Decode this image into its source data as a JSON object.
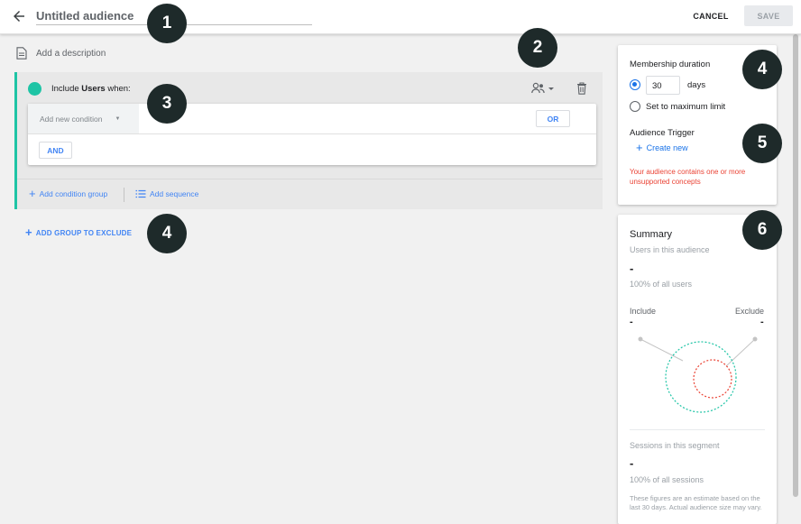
{
  "header": {
    "title": "Untitled audience",
    "cancel_label": "CANCEL",
    "save_label": "SAVE"
  },
  "main": {
    "description_placeholder": "Add a description",
    "include_prefix": "Include",
    "include_scope": "Users",
    "include_suffix": "when:",
    "condition_placeholder": "Add new condition",
    "or_label": "OR",
    "and_label": "AND",
    "add_condition_group": "Add condition group",
    "add_sequence": "Add sequence",
    "add_group_to_exclude": "ADD GROUP TO EXCLUDE"
  },
  "membership": {
    "title": "Membership duration",
    "days_value": "30",
    "days_label": "days",
    "max_limit_label": "Set to maximum limit",
    "selected_option": "days",
    "trigger_title": "Audience Trigger",
    "create_new": "Create new",
    "warning": "Your audience contains one or more unsupported concepts"
  },
  "summary": {
    "title": "Summary",
    "users_label": "Users in this audience",
    "users_value": "-",
    "users_pct": "100% of all users",
    "include_label": "Include",
    "exclude_label": "Exclude",
    "include_value": "-",
    "exclude_value": "-",
    "sessions_label": "Sessions in this segment",
    "sessions_value": "-",
    "sessions_pct": "100% of all sessions",
    "footnote": "These figures are an estimate based on the last 30 days. Actual audience size may vary."
  },
  "annotations": [
    "1",
    "2",
    "3",
    "4",
    "4",
    "5",
    "6"
  ],
  "colors": {
    "accent": "#1a73e8",
    "teal": "#1ec4a5",
    "warning": "#ea4335",
    "badge": "#1e2a2a"
  }
}
